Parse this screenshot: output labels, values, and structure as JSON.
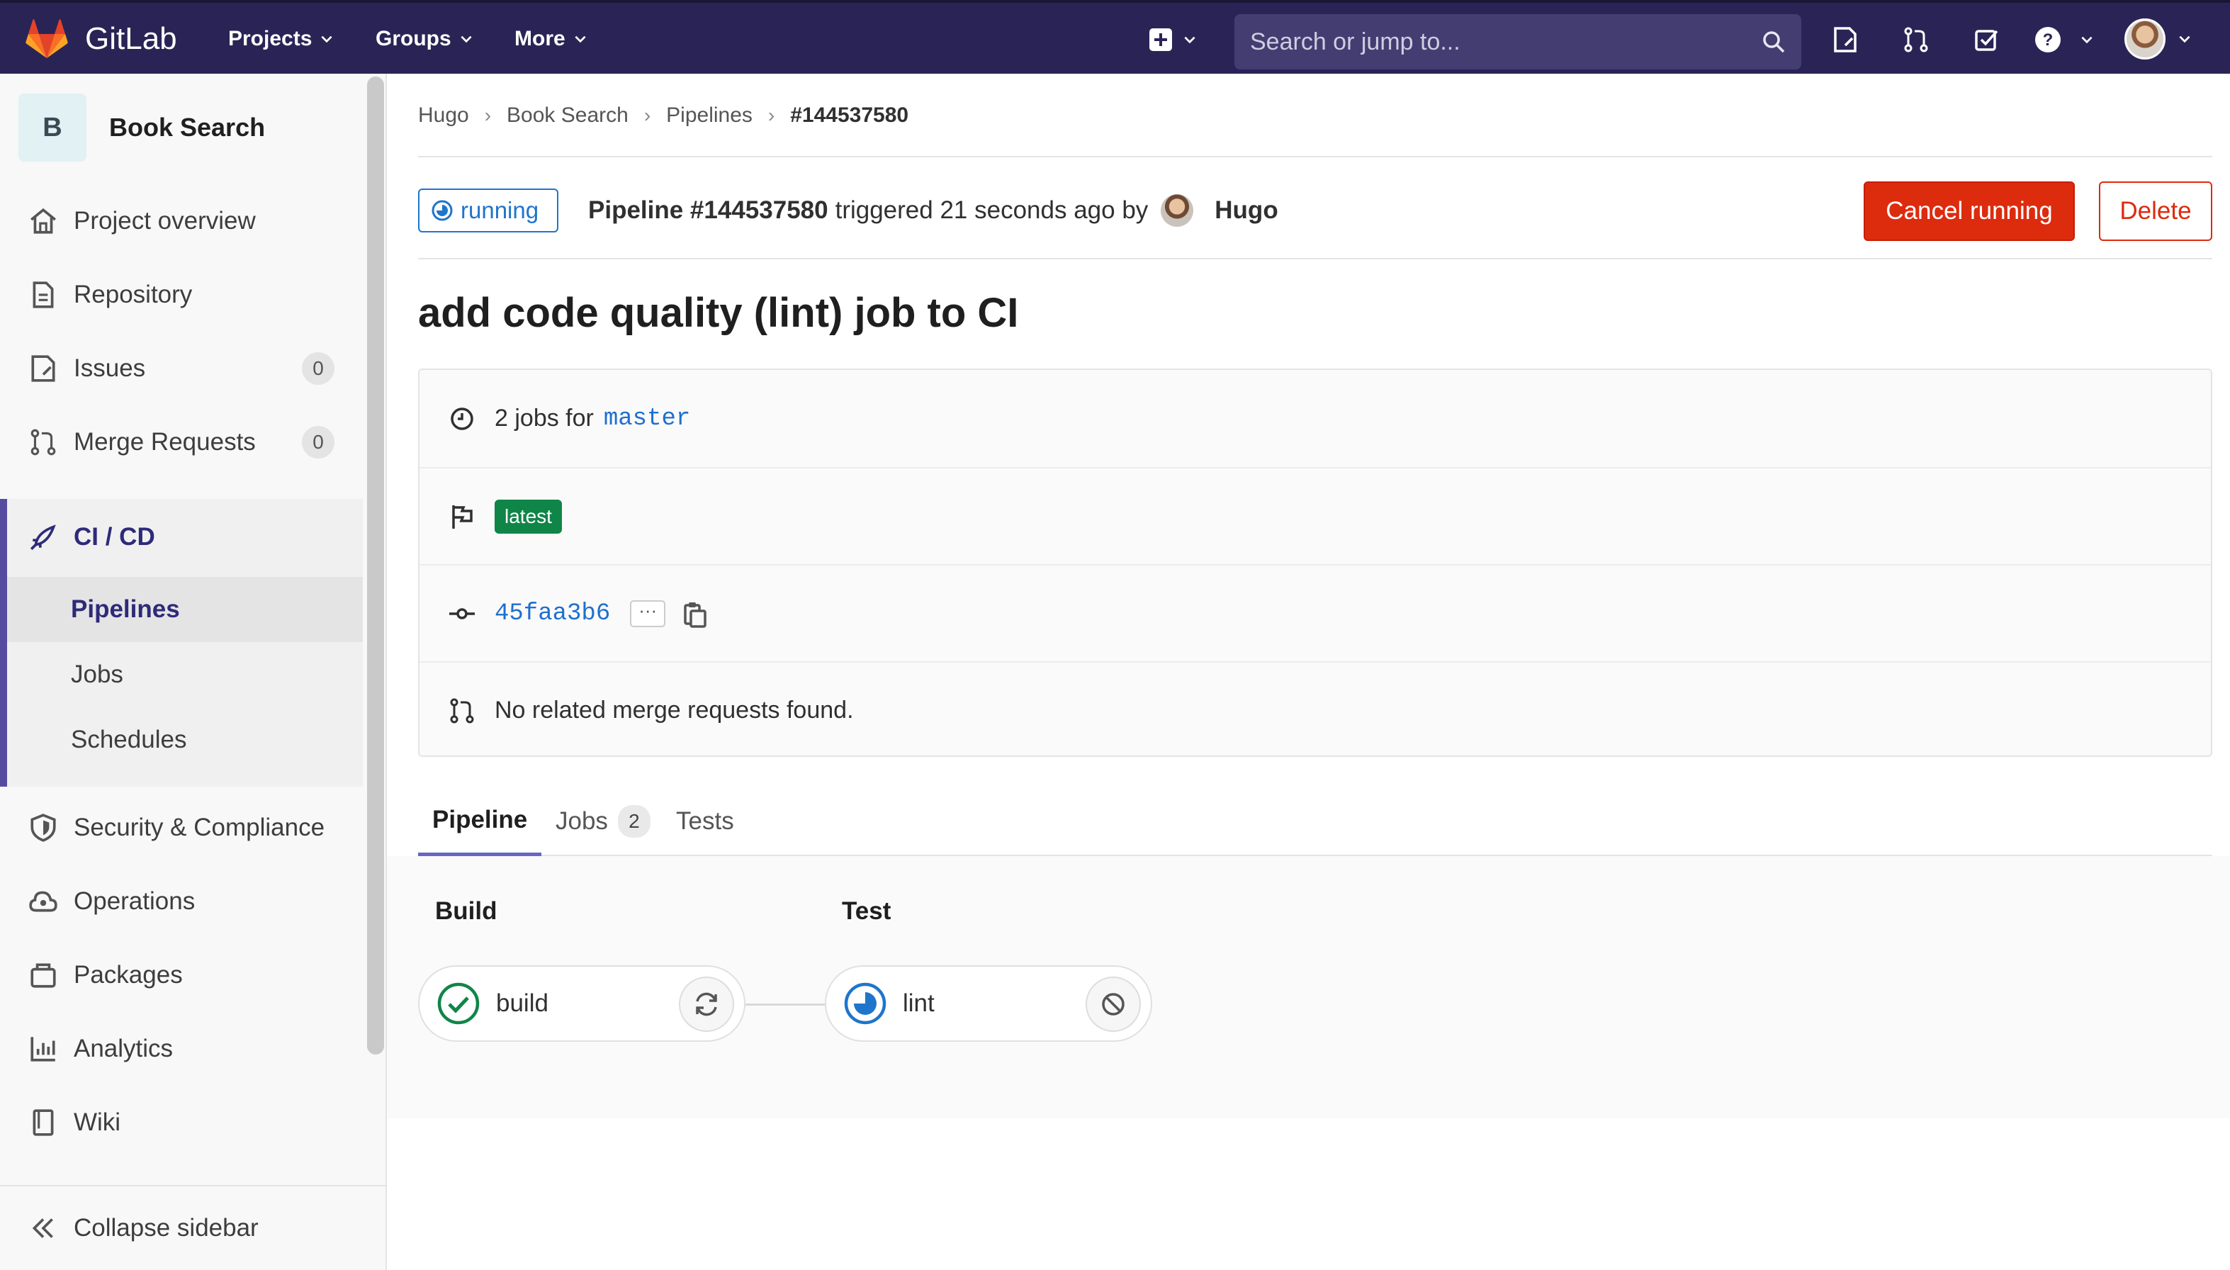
{
  "navbar": {
    "brand": "GitLab",
    "menus": [
      "Projects",
      "Groups",
      "More"
    ],
    "search_placeholder": "Search or jump to...",
    "icons": [
      "plus-icon",
      "search-icon",
      "issues-icon",
      "merge-request-icon",
      "todo-icon",
      "help-icon",
      "user-avatar"
    ]
  },
  "sidebar": {
    "project_initial": "B",
    "project_name": "Book Search",
    "items": [
      {
        "label": "Project overview",
        "icon": "home-icon"
      },
      {
        "label": "Repository",
        "icon": "document-icon"
      },
      {
        "label": "Issues",
        "icon": "issues-icon",
        "count": "0"
      },
      {
        "label": "Merge Requests",
        "icon": "merge-request-icon",
        "count": "0"
      },
      {
        "label": "CI / CD",
        "icon": "rocket-icon"
      },
      {
        "label": "Security & Compliance",
        "icon": "shield-icon"
      },
      {
        "label": "Operations",
        "icon": "cloud-gear-icon"
      },
      {
        "label": "Packages",
        "icon": "package-icon"
      },
      {
        "label": "Analytics",
        "icon": "chart-icon"
      },
      {
        "label": "Wiki",
        "icon": "book-icon"
      }
    ],
    "cicd_sub": [
      "Pipelines",
      "Jobs",
      "Schedules"
    ],
    "collapse_label": "Collapse sidebar"
  },
  "breadcrumb": [
    "Hugo",
    "Book Search",
    "Pipelines",
    "#144537580"
  ],
  "header": {
    "status": "running",
    "pipeline_label": "Pipeline #144537580",
    "triggered_text": "triggered 21 seconds ago by",
    "user": "Hugo",
    "cancel_label": "Cancel running",
    "delete_label": "Delete"
  },
  "commit_title": "add code quality (lint) job to CI",
  "info": {
    "jobs_text": "2 jobs for",
    "branch": "master",
    "tag": "latest",
    "sha": "45faa3b6",
    "ellipsis": "···",
    "mr_text": "No related merge requests found."
  },
  "tabs": [
    {
      "label": "Pipeline"
    },
    {
      "label": "Jobs",
      "count": "2"
    },
    {
      "label": "Tests"
    }
  ],
  "stages": [
    {
      "title": "Build",
      "job": "build",
      "job_status": "success",
      "action": "retry"
    },
    {
      "title": "Test",
      "job": "lint",
      "job_status": "running",
      "action": "cancel"
    }
  ],
  "colors": {
    "navbar": "#2a2456",
    "accent": "#554ba0",
    "danger": "#dd2b0e",
    "running": "#1f75cb",
    "success": "#108548"
  }
}
